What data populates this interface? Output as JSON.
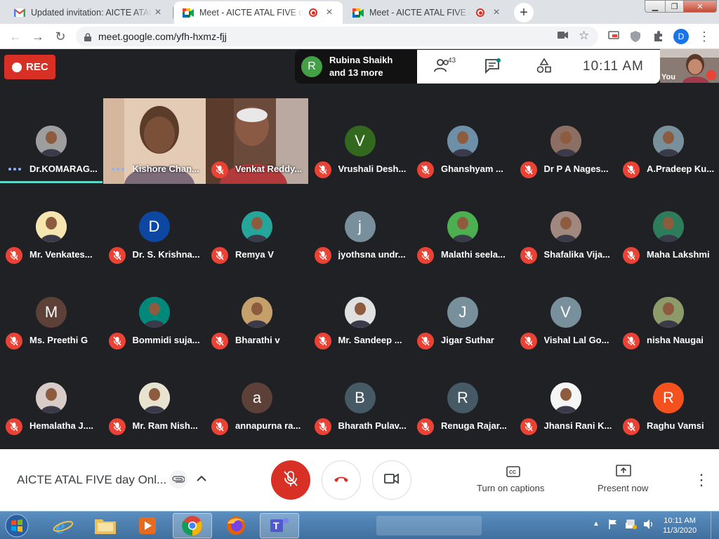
{
  "browser": {
    "tabs": [
      {
        "title": "Updated invitation: AICTE ATAL FIVE",
        "favicon": "gmail-icon"
      },
      {
        "title": "Meet - AICTE ATAL FIVE day",
        "favicon": "meet-icon"
      },
      {
        "title": "Meet - AICTE ATAL FIVE day",
        "favicon": "meet-icon"
      }
    ],
    "tab_close": "×",
    "new_tab": "+",
    "window_controls": {
      "minimize": "▁",
      "maximize": "❐",
      "close": "✕"
    },
    "url": "meet.google.com/yfh-hxmz-fjj",
    "profile_initial": "D"
  },
  "meet": {
    "rec_label": "REC",
    "presenter": {
      "initial": "R",
      "line1": "Rubina Shaikh",
      "line2": "and 13 more"
    },
    "participants_count": "43",
    "time": "10:11  AM",
    "self_label": "You",
    "meeting_title": "AICTE ATAL FIVE day Onl...",
    "captions_label": "Turn on captions",
    "present_label": "Present now",
    "participants": [
      {
        "name": "Dr.KOMARAG...",
        "initial": "",
        "color": "#9e9e9e",
        "state": "dots"
      },
      {
        "name": "Kishore Chan...",
        "initial": "",
        "color": "#c9a27d",
        "state": "dots"
      },
      {
        "name": "Venkat Reddy...",
        "initial": "",
        "color": "#b08060",
        "state": "muted"
      },
      {
        "name": "Vrushali Desh...",
        "initial": "V",
        "color": "#33691e",
        "state": "muted"
      },
      {
        "name": "Ghanshyam ...",
        "initial": "",
        "color": "#6d8fa8",
        "state": "muted"
      },
      {
        "name": "Dr P A Nages...",
        "initial": "",
        "color": "#8d6e63",
        "state": "muted"
      },
      {
        "name": "A.Pradeep Ku...",
        "initial": "",
        "color": "#78909c",
        "state": "muted"
      },
      {
        "name": "Mr. Venkates...",
        "initial": "",
        "color": "#f5e6b0",
        "state": "muted"
      },
      {
        "name": "Dr. S. Krishna...",
        "initial": "D",
        "color": "#0d47a1",
        "state": "muted"
      },
      {
        "name": "Remya V",
        "initial": "",
        "color": "#26a69a",
        "state": "muted"
      },
      {
        "name": "jyothsna undr...",
        "initial": "j",
        "color": "#78909c",
        "state": "muted"
      },
      {
        "name": "Malathi seela...",
        "initial": "",
        "color": "#4caf50",
        "state": "muted"
      },
      {
        "name": "Shafalika Vija...",
        "initial": "",
        "color": "#a1887f",
        "state": "muted"
      },
      {
        "name": "Maha Lakshmi",
        "initial": "",
        "color": "#2e7d5a",
        "state": "muted"
      },
      {
        "name": "Ms. Preethi G",
        "initial": "M",
        "color": "#5d4037",
        "state": "muted"
      },
      {
        "name": "Bommidi suja...",
        "initial": "",
        "color": "#00897b",
        "state": "muted"
      },
      {
        "name": "Bharathi v",
        "initial": "",
        "color": "#c5a06a",
        "state": "muted"
      },
      {
        "name": "Mr. Sandeep ...",
        "initial": "",
        "color": "#e0e0e0",
        "state": "muted"
      },
      {
        "name": "Jigar Suthar",
        "initial": "J",
        "color": "#78909c",
        "state": "muted"
      },
      {
        "name": "Vishal Lal Go...",
        "initial": "V",
        "color": "#78909c",
        "state": "muted"
      },
      {
        "name": "nisha Naugai",
        "initial": "",
        "color": "#8d9b6a",
        "state": "muted"
      },
      {
        "name": "Hemalatha J....",
        "initial": "",
        "color": "#d7ccc8",
        "state": "muted"
      },
      {
        "name": "Mr. Ram Nish...",
        "initial": "",
        "color": "#e8e2d0",
        "state": "muted"
      },
      {
        "name": "annapurna ra...",
        "initial": "a",
        "color": "#5d4037",
        "state": "muted"
      },
      {
        "name": "Bharath Pulav...",
        "initial": "B",
        "color": "#455a64",
        "state": "muted"
      },
      {
        "name": "Renuga Rajar...",
        "initial": "R",
        "color": "#455a64",
        "state": "muted"
      },
      {
        "name": "Jhansi Rani K...",
        "initial": "",
        "color": "#f5f5f5",
        "state": "muted"
      },
      {
        "name": "Raghu Vamsi",
        "initial": "R",
        "color": "#f4511e",
        "state": "muted"
      }
    ]
  },
  "taskbar": {
    "time": "10:11 AM",
    "date": "11/3/2020",
    "apps": [
      "start-button",
      "ie-icon",
      "explorer-icon",
      "media-player-icon",
      "chrome-icon",
      "firefox-icon",
      "teams-icon"
    ]
  },
  "colors": {
    "danger": "#ea4335",
    "rec": "#d93025",
    "meet_bg": "#202124",
    "accent": "#1a73e8"
  }
}
